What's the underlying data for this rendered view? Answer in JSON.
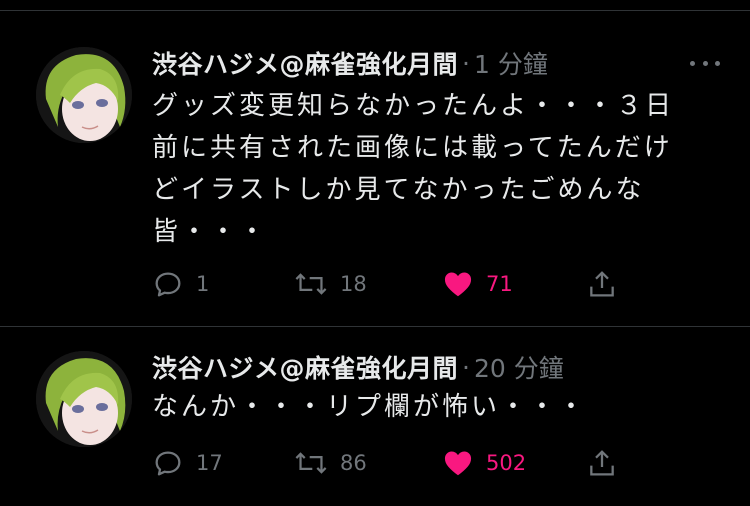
{
  "colors": {
    "background": "#000000",
    "text": "#e7e9ea",
    "secondary": "#71767b",
    "divider": "#2f3336",
    "like": "#f91880"
  },
  "tweets": [
    {
      "author": "渋谷ハジメ@麻雀強化月間",
      "separator": "·",
      "time": "1 分鐘",
      "text": "グッズ変更知らなかったんよ・・・３日\n前に共有された画像には載ってたんだけ\nどイラストしか見てなかったごめんな\n皆・・・",
      "replies": "1",
      "retweets": "18",
      "likes": "71",
      "liked": true
    },
    {
      "author": "渋谷ハジメ@麻雀強化月間",
      "separator": "·",
      "time": "20 分鐘",
      "text": "なんか・・・リプ欄が怖い・・・",
      "replies": "17",
      "retweets": "86",
      "likes": "502",
      "liked": true
    }
  ],
  "icons": {
    "more": "more-horizontal-icon",
    "reply": "reply-bubble-icon",
    "retweet": "retweet-icon",
    "like": "heart-icon",
    "share": "share-upload-icon"
  }
}
